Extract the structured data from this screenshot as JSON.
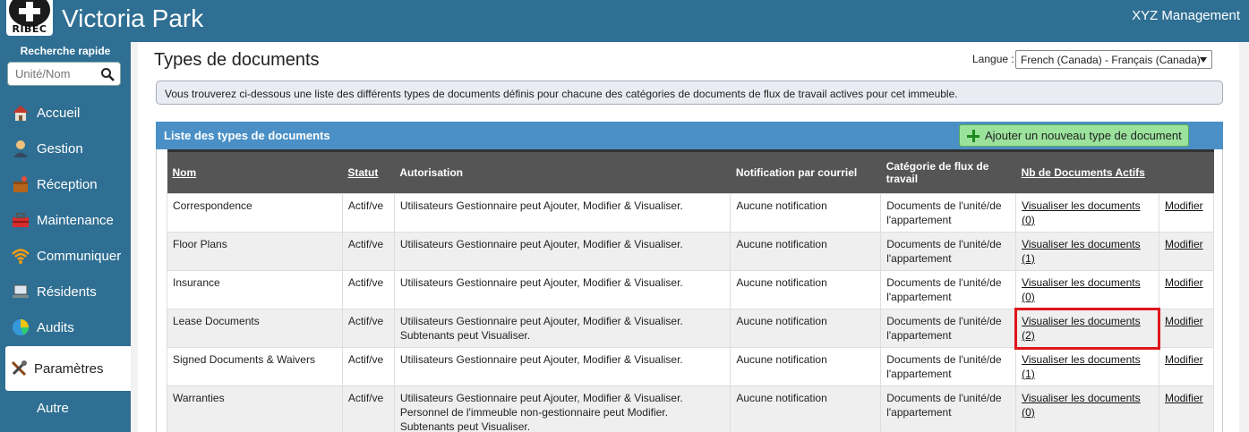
{
  "header": {
    "logo_text": "RIBEC",
    "site_title": "Victoria Park",
    "management": "XYZ Management"
  },
  "sidebar": {
    "quick_search_label": "Recherche rapide",
    "quick_search_placeholder": "Unité/Nom",
    "items": [
      {
        "label": "Accueil",
        "icon": "house-icon"
      },
      {
        "label": "Gestion",
        "icon": "person-icon"
      },
      {
        "label": "Réception",
        "icon": "package-icon"
      },
      {
        "label": "Maintenance",
        "icon": "toolbox-icon"
      },
      {
        "label": "Communiquer",
        "icon": "wifi-icon"
      },
      {
        "label": "Résidents",
        "icon": "laptop-icon"
      },
      {
        "label": "Audits",
        "icon": "pie-chart-icon"
      },
      {
        "label": "Paramètres",
        "icon": "tools-icon"
      },
      {
        "label": "Autre",
        "icon": ""
      }
    ],
    "active_item": "Paramètres"
  },
  "page": {
    "title": "Types de documents",
    "language_label": "Langue :",
    "language_value": "French (Canada) - Français (Canada)",
    "info_text": "Vous trouverez ci-dessous une liste des différents types de documents définis pour chacune des catégories de documents de flux de travail actives pour cet immeuble.",
    "panel_title": "Liste des types de documents",
    "add_button": "Ajouter un nouveau type de document"
  },
  "table": {
    "columns": [
      "Nom",
      "Statut",
      "Autorisation",
      "Notification par courriel",
      "Catégorie de flux de travail",
      "Nb de Documents Actifs",
      ""
    ],
    "rows": [
      {
        "name": "Correspondence",
        "status": "Actif/ve",
        "auth": [
          "Utilisateurs Gestionnaire peut Ajouter, Modifier & Visualiser."
        ],
        "notif": "Aucune notification",
        "category": "Documents de l'unité/de l'appartement",
        "view": "Visualiser les documents (0)",
        "edit": "Modifier"
      },
      {
        "name": "Floor Plans",
        "status": "Actif/ve",
        "auth": [
          "Utilisateurs Gestionnaire peut Ajouter, Modifier & Visualiser."
        ],
        "notif": "Aucune notification",
        "category": "Documents de l'unité/de l'appartement",
        "view": "Visualiser les documents (1)",
        "edit": "Modifier"
      },
      {
        "name": "Insurance",
        "status": "Actif/ve",
        "auth": [
          "Utilisateurs Gestionnaire peut Ajouter, Modifier & Visualiser."
        ],
        "notif": "Aucune notification",
        "category": "Documents de l'unité/de l'appartement",
        "view": "Visualiser les documents (0)",
        "edit": "Modifier"
      },
      {
        "name": "Lease Documents",
        "status": "Actif/ve",
        "auth": [
          "Utilisateurs Gestionnaire peut Ajouter, Modifier & Visualiser.",
          "Subtenants peut Visualiser."
        ],
        "notif": "Aucune notification",
        "category": "Documents de l'unité/de l'appartement",
        "view": "Visualiser les documents (2)",
        "edit": "Modifier",
        "highlight": true
      },
      {
        "name": "Signed Documents & Waivers",
        "status": "Actif/ve",
        "auth": [
          "Utilisateurs Gestionnaire peut Ajouter, Modifier & Visualiser."
        ],
        "notif": "Aucune notification",
        "category": "Documents de l'unité/de l'appartement",
        "view": "Visualiser les documents (1)",
        "edit": "Modifier"
      },
      {
        "name": "Warranties",
        "status": "Actif/ve",
        "auth": [
          "Utilisateurs Gestionnaire peut Ajouter, Modifier & Visualiser.",
          "Personnel de l'immeuble non-gestionnaire peut Modifier.",
          "Subtenants peut Visualiser."
        ],
        "notif": "Aucune notification",
        "category": "Documents de l'unité/de l'appartement",
        "view": "Visualiser les documents (0)",
        "edit": "Modifier"
      }
    ]
  }
}
